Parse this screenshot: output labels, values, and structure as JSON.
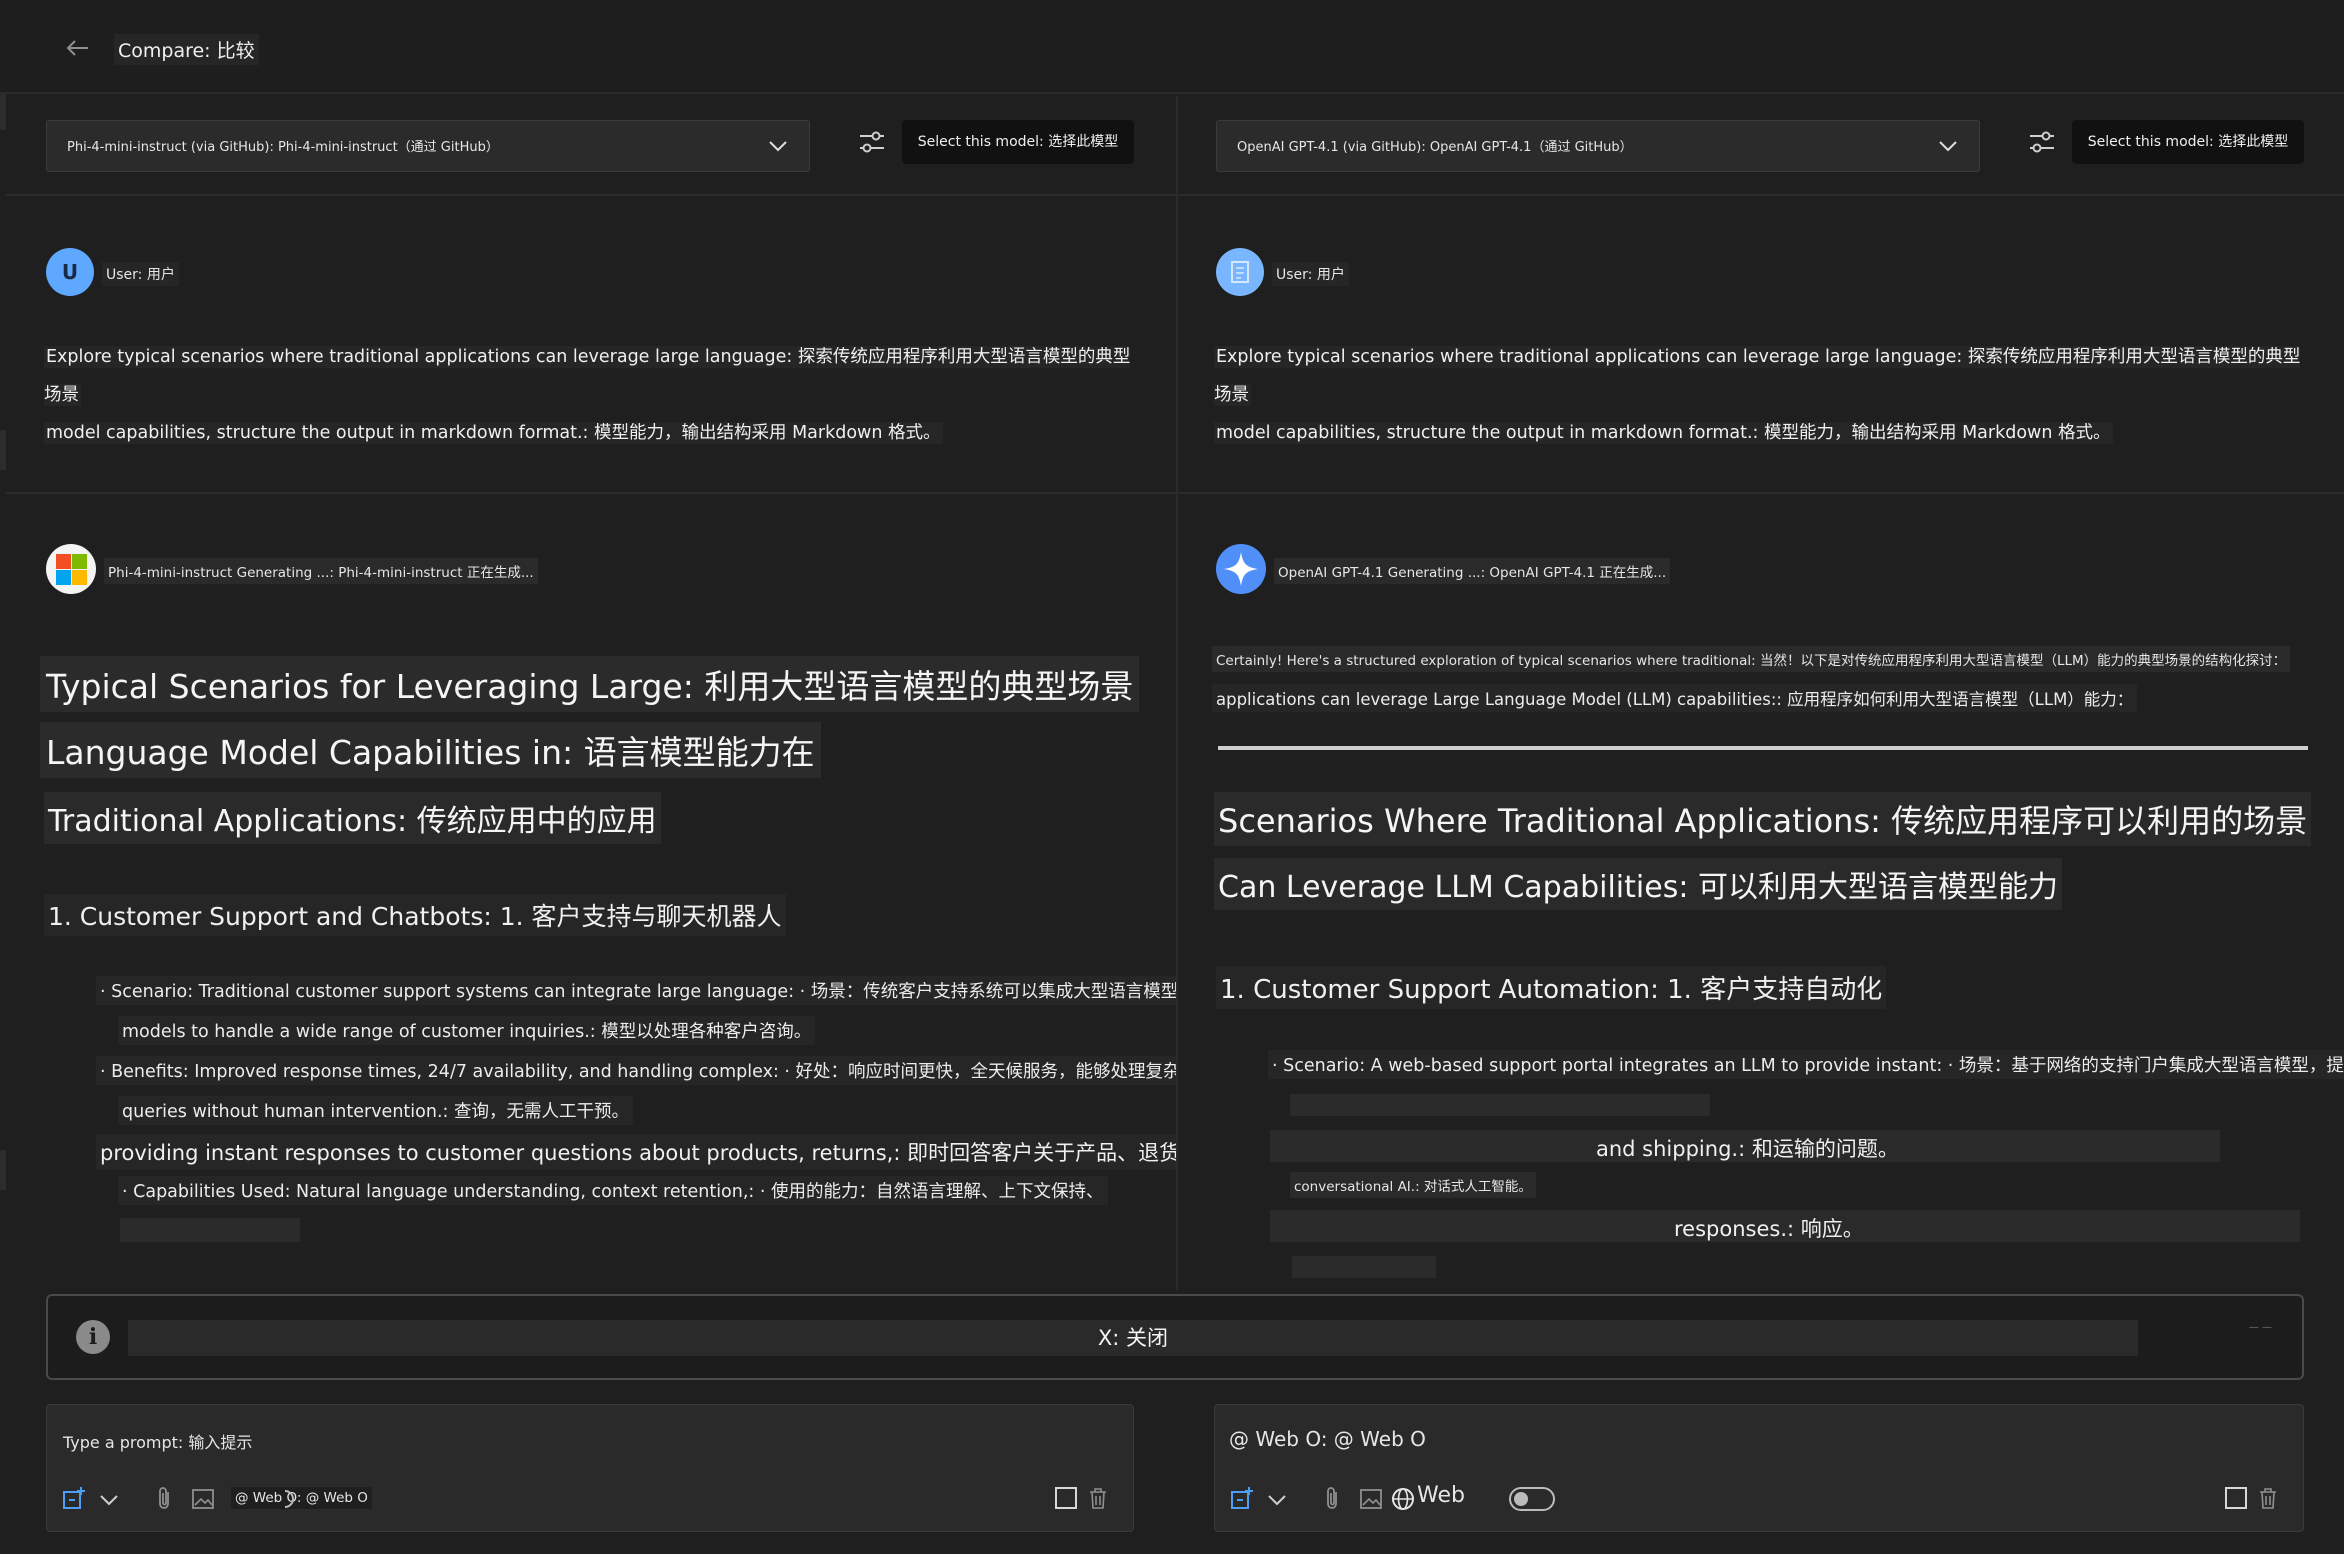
{
  "header": {
    "title": "Compare: 比较"
  },
  "left": {
    "model_selector": "Phi-4-mini-instruct (via GitHub): Phi-4-mini-instruct（通过 GitHub）",
    "select_button": "Select this model: 选择此模型",
    "user_label": "User: 用户",
    "user_avatar": "U",
    "user_message_line1": "Explore typical scenarios where traditional applications can leverage large language: 探索传统应用程序利用大型语言模型的典型场景",
    "user_message_line2": "model capabilities, structure the output in markdown format.: 模型能力，输出结构采用 Markdown 格式。",
    "status": "Phi-4-mini-instruct Generating ...: Phi-4-mini-instruct 正在生成...",
    "h1_line1": "Typical Scenarios for Leveraging Large: 利用大型语言模型的典型场景",
    "h1_line2": "Language Model Capabilities in: 语言模型能力在",
    "h2": "Traditional Applications: 传统应用中的应用",
    "h3": "1. Customer Support and Chatbots: 1. 客户支持与聊天机器人",
    "b1_line1": "· Scenario: Traditional customer support systems can integrate large language: · 场景：传统客户支持系统可以集成大型语言模型",
    "b1_line2": "models to handle a wide range of customer inquiries.: 模型以处理各种客户咨询。",
    "b2_line1": "· Benefits: Improved response times, 24/7 availability, and handling complex: · 好处：响应时间更快，全天候服务，能够处理复杂",
    "b2_line2": "queries without human intervention.: 查询，无需人工干预。",
    "b3": "providing instant responses to customer questions about products, returns,: 即时回答客户关于产品、退货、",
    "b4": "· Capabilities Used: Natural language understanding, context retention,: · 使用的能力：自然语言理解、上下文保持、"
  },
  "right": {
    "model_selector": "OpenAI GPT-4.1 (via GitHub): OpenAI GPT-4.1（通过 GitHub）",
    "select_button": "Select this model: 选择此模型",
    "user_label": "User: 用户",
    "user_message_line1": "Explore typical scenarios where traditional applications can leverage large language: 探索传统应用程序利用大型语言模型的典型场景",
    "user_message_line2": "model capabilities, structure the output in markdown format.: 模型能力，输出结构采用 Markdown 格式。",
    "status": "OpenAI GPT-4.1 Generating ...: OpenAI GPT-4.1 正在生成...",
    "intro_line1": "Certainly! Here's a structured exploration of typical scenarios where traditional: 当然！以下是对传统应用程序利用大型语言模型（LLM）能力的典型场景的结构化探讨：",
    "intro_line2": "applications can leverage Large Language Model (LLM) capabilities:: 应用程序如何利用大型语言模型（LLM）能力：",
    "h1_line1": "Scenarios Where Traditional Applications: 传统应用程序可以利用的场景",
    "h1_line2": "Can Leverage LLM Capabilities: 可以利用大型语言模型能力",
    "h3": "1. Customer Support Automation: 1. 客户支持自动化",
    "b1": "· Scenario: A web-based support portal integrates an LLM to provide instant: · 场景：基于网络的支持门户集成大型语言模型，提供即时",
    "b2": "and shipping.: 和运输的问题。",
    "b3": "conversational AI.: 对话式人工智能。",
    "b4": "responses.: 响应。"
  },
  "info_bar": {
    "close_label": "X: 关闭"
  },
  "prompt_left": {
    "placeholder": "Type a prompt: 输入提示",
    "web_chip": "@ Web O: @ Web O"
  },
  "prompt_right": {
    "text": "@ Web O: @ Web O",
    "web_label": "Web"
  }
}
